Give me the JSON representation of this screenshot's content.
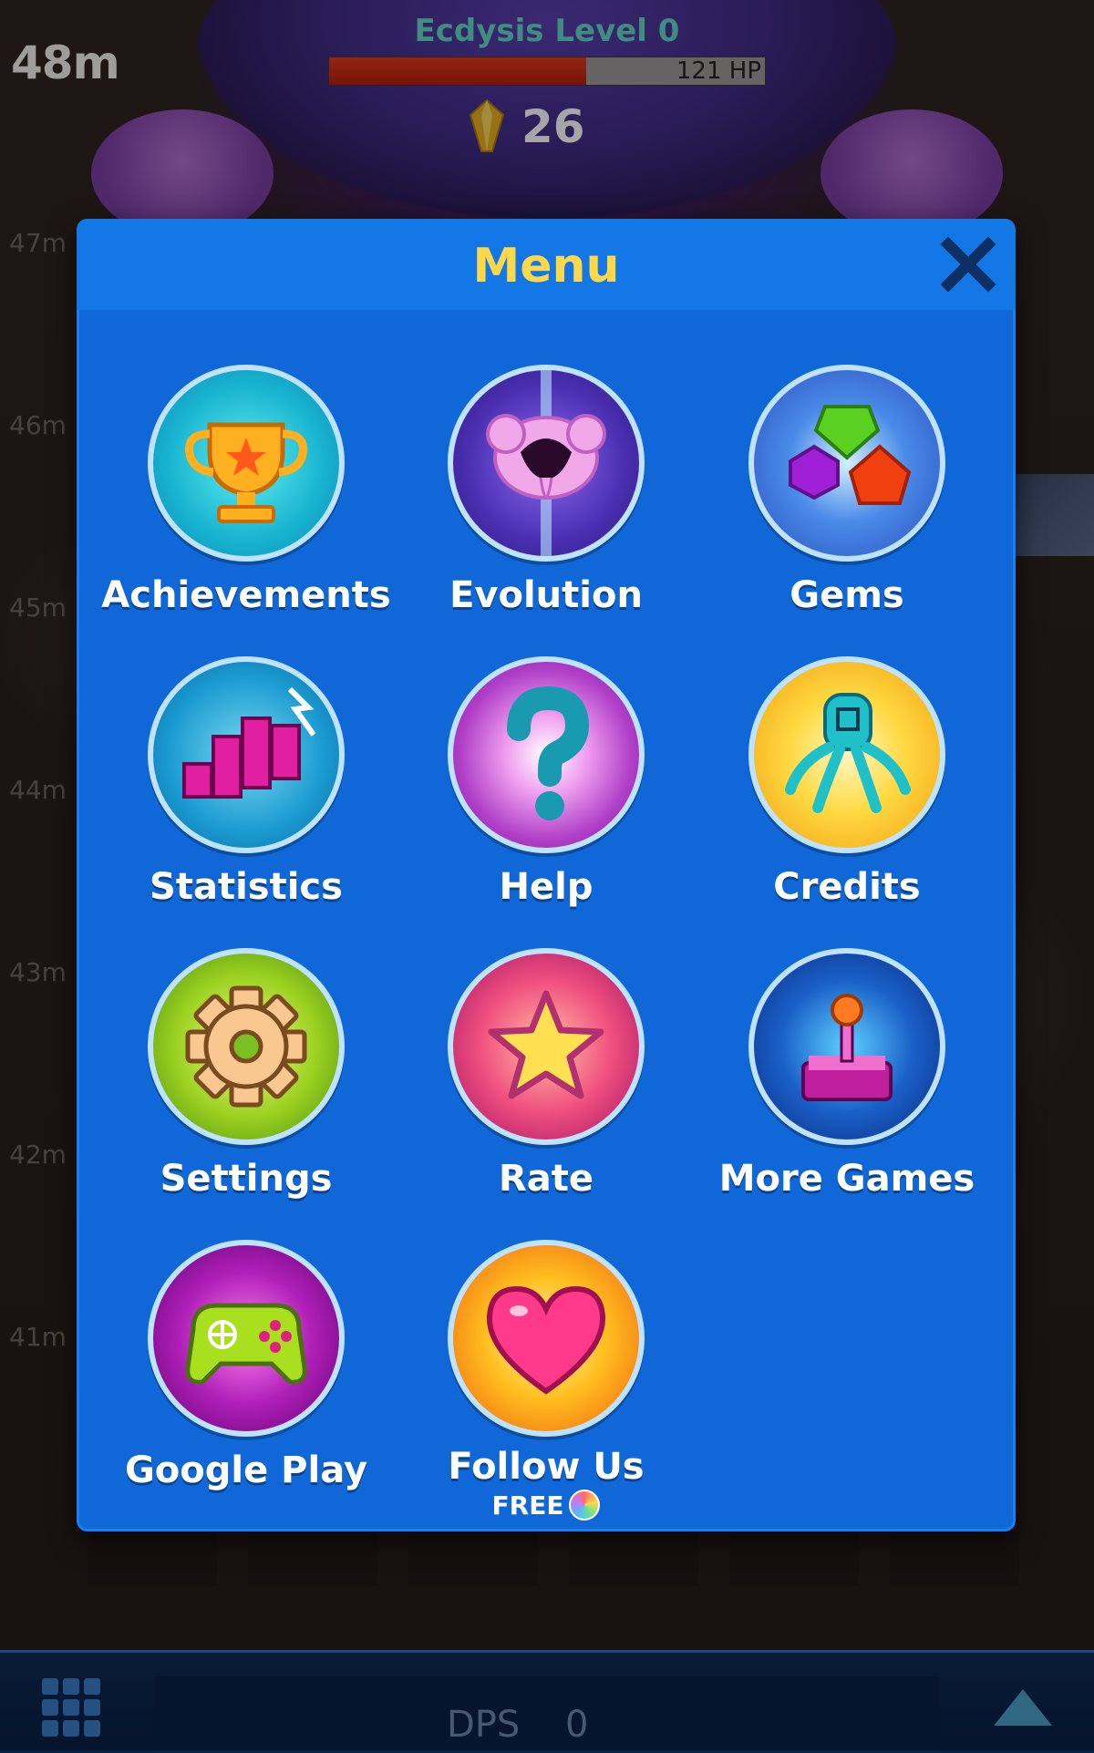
{
  "hud": {
    "depth_current": "48m",
    "level_title": "Ecdysis Level 0",
    "hp_text": "121 HP",
    "hp_fraction": 0.59,
    "gem_count": "26"
  },
  "depth_markers": [
    "47m",
    "46m",
    "45m",
    "44m",
    "43m",
    "42m",
    "41m"
  ],
  "menu": {
    "title": "Menu",
    "items": [
      {
        "label": "Achievements",
        "icon": "trophy-icon",
        "color": "#22b8d6"
      },
      {
        "label": "Evolution",
        "icon": "creature-icon",
        "color": "#5a3fc0"
      },
      {
        "label": "Gems",
        "icon": "gems-icon",
        "color": "#3a6ad8"
      },
      {
        "label": "Statistics",
        "icon": "bar-chart-icon",
        "color": "#1a9ad0"
      },
      {
        "label": "Help",
        "icon": "question-icon",
        "color": "#b040c8"
      },
      {
        "label": "Credits",
        "icon": "octopus-icon",
        "color": "#f0b820"
      },
      {
        "label": "Settings",
        "icon": "gear-icon",
        "color": "#7ac020"
      },
      {
        "label": "Rate",
        "icon": "star-icon",
        "color": "#e04070"
      },
      {
        "label": "More Games",
        "icon": "joystick-icon",
        "color": "#1a5ac8"
      },
      {
        "label": "Google Play",
        "icon": "gamepad-icon",
        "color": "#a020a8"
      },
      {
        "label": "Follow Us",
        "icon": "heart-icon",
        "color": "#f09020",
        "sub": "FREE"
      }
    ]
  },
  "bottom_bar": {
    "dps_label": "DPS",
    "dps_value": "0"
  }
}
